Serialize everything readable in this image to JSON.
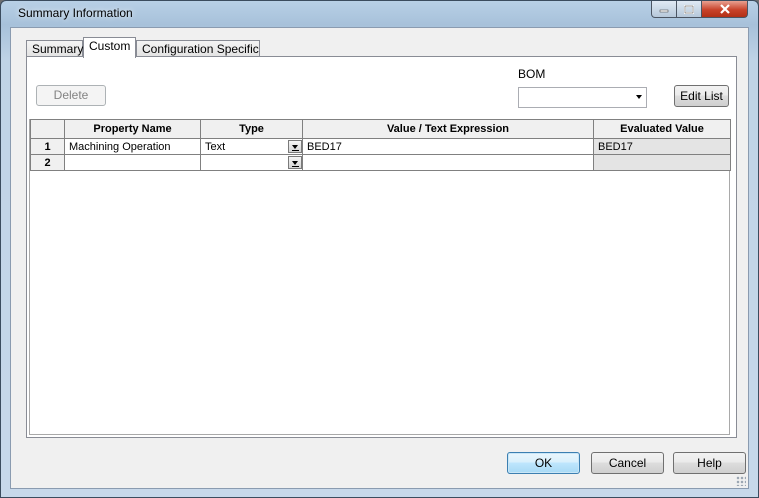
{
  "window": {
    "title": "Summary Information"
  },
  "tabs": [
    {
      "label": "Summary",
      "active": false
    },
    {
      "label": "Custom",
      "active": true
    },
    {
      "label": "Configuration Specific",
      "active": false
    }
  ],
  "toolbar": {
    "delete_label": "Delete",
    "bom_label": "BOM",
    "bom_value": "",
    "edit_list_label": "Edit List"
  },
  "grid": {
    "columns": [
      "",
      "Property Name",
      "Type",
      "Value / Text Expression",
      "Evaluated Value"
    ],
    "rows": [
      {
        "num": "1",
        "property_name": "Machining Operation",
        "type": "Text",
        "value": "BED17",
        "evaluated": "BED17"
      },
      {
        "num": "2",
        "property_name": "",
        "type": "",
        "value": "",
        "evaluated": ""
      }
    ]
  },
  "footer": {
    "ok_label": "OK",
    "cancel_label": "Cancel",
    "help_label": "Help"
  },
  "colors": {
    "accent": "#3c7fb1",
    "close": "#c8432b",
    "frame": "#a7c1da"
  }
}
